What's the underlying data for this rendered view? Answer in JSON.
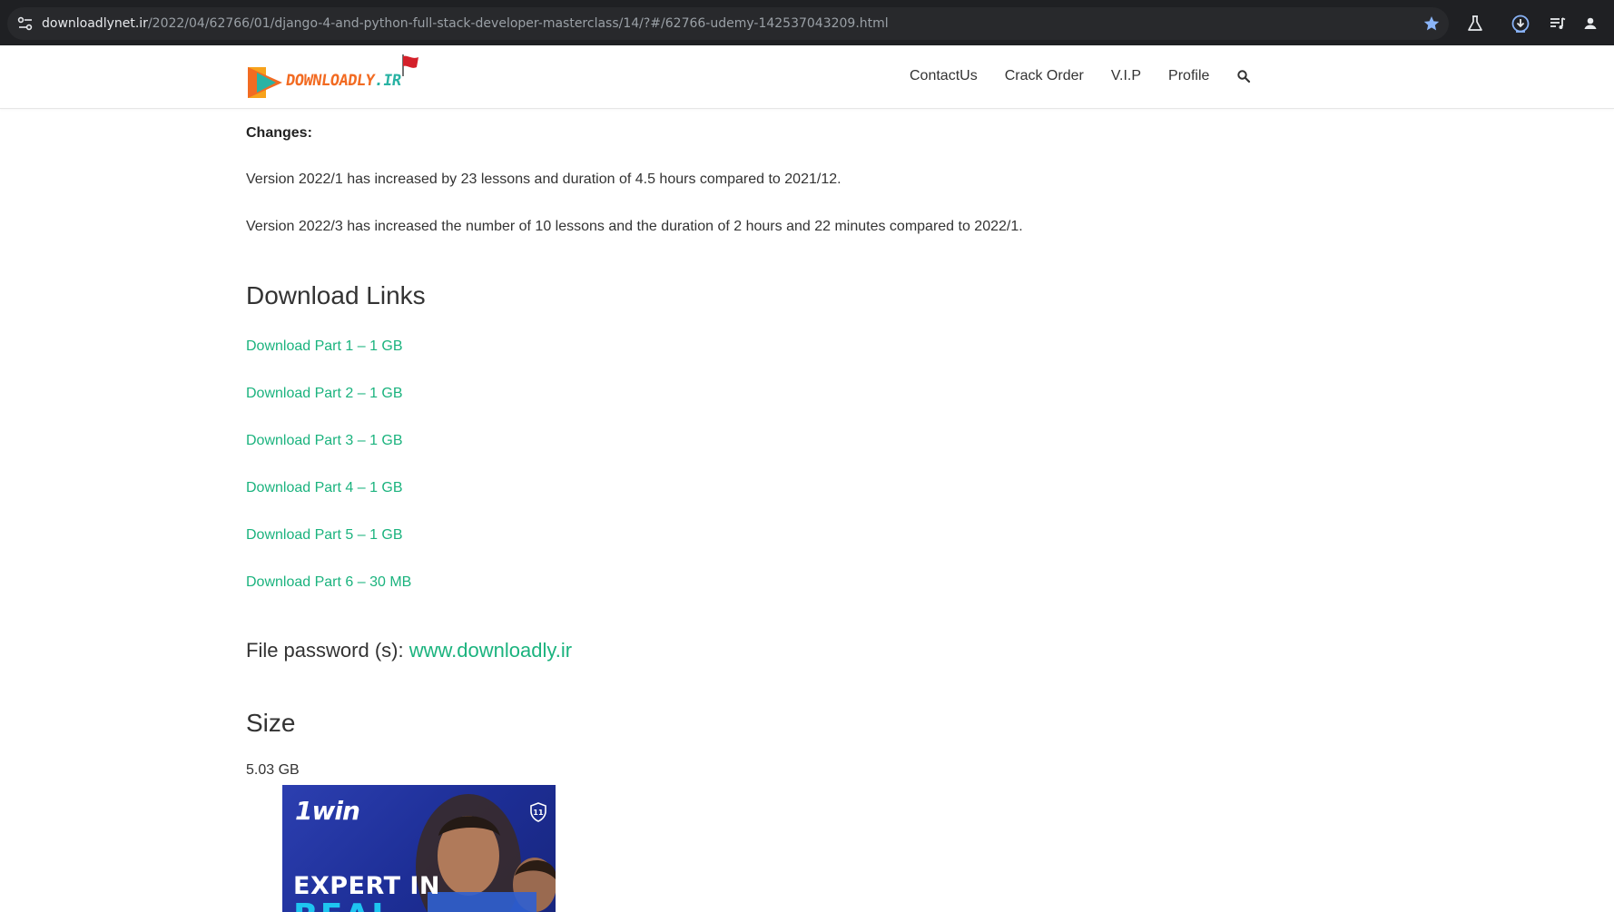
{
  "browser": {
    "url_host": "downloadlynet.ir",
    "url_path": "/2022/04/62766/01/django-4-and-python-full-stack-developer-masterclass/14/?#/62766-udemy-142537043209.html",
    "icons": [
      "site-info-icon",
      "bookmark-star-icon",
      "labs-flask-icon",
      "download-icon",
      "media-controls-icon",
      "profile-icon"
    ]
  },
  "header": {
    "logo_text": "DOWNLOADLY",
    "logo_suffix": ".IR",
    "nav": [
      "ContactUs",
      "Crack Order",
      "V.I.P",
      "Profile"
    ],
    "search_icon": "search-icon"
  },
  "content": {
    "changes_label": "Changes:",
    "change_1": "Version 2022/1 has increased by 23 lessons and duration of 4.5 hours compared to 2021/12.",
    "change_2": "Version 2022/3 has increased the number of 10 lessons and the duration of 2 hours and 22 minutes compared to 2022/1.",
    "download_heading": "Download Links",
    "download_links": [
      "Download Part 1 – 1 GB",
      "Download Part 2 – 1 GB",
      "Download Part 3 – 1 GB",
      "Download Part 4 – 1 GB",
      "Download Part 5 – 1 GB",
      "Download Part 6 – 30 MB"
    ],
    "password_label": "File password (s):",
    "password_value": "www.downloadly.ir",
    "size_heading": "Size",
    "size_value": "5.03 GB"
  },
  "ad": {
    "brand": "1win",
    "headline": "EXPERT IN",
    "headline_2": "REAL"
  },
  "colors": {
    "link_green": "#1bb37e",
    "chrome_bg": "#1f2023",
    "logo_orange": "#f26b22",
    "logo_teal": "#2ab3a4",
    "ad_blue": "#1d2e96"
  }
}
